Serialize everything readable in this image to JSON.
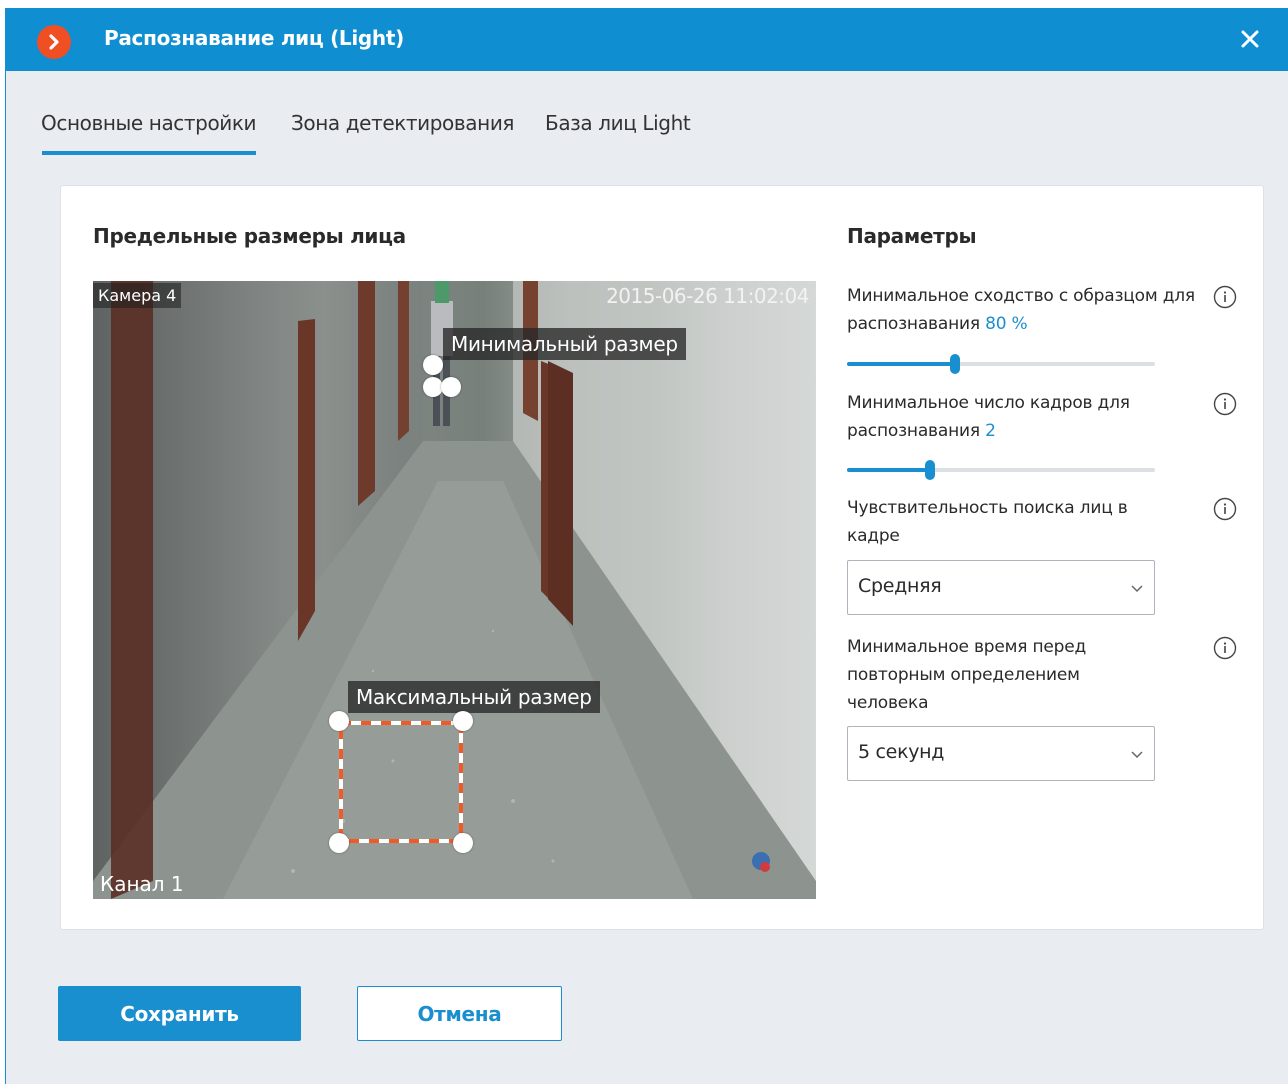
{
  "window": {
    "title": "Распознавание лиц (Light)",
    "close_icon": "close-icon",
    "logo_icon": "app-logo-chevron-icon"
  },
  "tabs": [
    {
      "label": "Основные настройки",
      "active": true
    },
    {
      "label": "Зона детектирования",
      "active": false
    },
    {
      "label": "База лиц Light",
      "active": false
    }
  ],
  "left_section": {
    "title": "Предельные размеры лица",
    "camera": {
      "name": "Камера 4",
      "timestamp": "2015-06-26 11:02:04",
      "channel": "Канал 1",
      "min_label": "Минимальный размер",
      "max_label": "Максимальный размер"
    }
  },
  "right_section": {
    "title": "Параметры",
    "similarity": {
      "label": "Минимальное сходство с образцом для распознавания",
      "value": "80",
      "unit": "%",
      "slider_fraction": 0.35
    },
    "frames": {
      "label": "Минимальное число кадров для распознавания",
      "value": "2",
      "slider_fraction": 0.27
    },
    "sensitivity": {
      "label": "Чувствительность поиска лиц в кадре",
      "value": "Средняя"
    },
    "repeat_time": {
      "label": "Минимальное время перед повторным определением человека",
      "value": "5 секунд"
    }
  },
  "buttons": {
    "save": "Сохранить",
    "cancel": "Отмена"
  },
  "colors": {
    "accent": "#1a8fcf",
    "titlebar": "#0f8fd2",
    "logo": "#f04e23",
    "max_box_dash": "#f15a24"
  }
}
